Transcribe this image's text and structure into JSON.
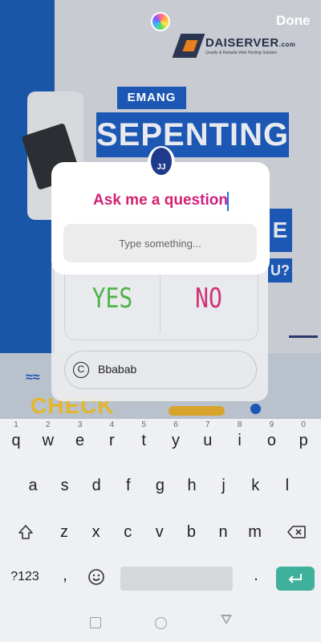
{
  "top_bar": {
    "done_label": "Done"
  },
  "background": {
    "logo_name": "DAISERVER",
    "logo_suffix": ".com",
    "logo_tagline": "Quality & Reliable Web Hosting Solution",
    "emang": "EMANG",
    "sepenting": "SEPENTING",
    "side_letter": "E",
    "side_letters_2": "U?",
    "check": "CHECK",
    "waves": "≈≈"
  },
  "question_sticker": {
    "title": "Ask me a question",
    "avatar_initials": "JJ",
    "input_placeholder": "Type something..."
  },
  "poll_sticker": {
    "yes_label": "YES",
    "no_label": "NO"
  },
  "mention_sticker": {
    "icon_glyph": "C",
    "label": "Bbabab"
  },
  "keyboard": {
    "row1": [
      {
        "letter": "q",
        "num": "1"
      },
      {
        "letter": "w",
        "num": "2"
      },
      {
        "letter": "e",
        "num": "3"
      },
      {
        "letter": "r",
        "num": "4"
      },
      {
        "letter": "t",
        "num": "5"
      },
      {
        "letter": "y",
        "num": "6"
      },
      {
        "letter": "u",
        "num": "7"
      },
      {
        "letter": "i",
        "num": "8"
      },
      {
        "letter": "o",
        "num": "9"
      },
      {
        "letter": "p",
        "num": "0"
      }
    ],
    "row2": [
      "a",
      "s",
      "d",
      "f",
      "g",
      "h",
      "j",
      "k",
      "l"
    ],
    "row3": [
      "z",
      "x",
      "c",
      "v",
      "b",
      "n",
      "m"
    ],
    "symbols_label": "?123",
    "comma_label": ",",
    "period_label": ".",
    "enter_icon": "enter-icon",
    "shift_icon": "shift-icon",
    "backspace_icon": "backspace-icon",
    "emoji_icon": "emoji-icon"
  },
  "colors": {
    "accent_enter": "#3fb09c",
    "title_magenta": "#c2207f",
    "yes_green": "#4fb34a",
    "no_pink": "#cf3377"
  }
}
